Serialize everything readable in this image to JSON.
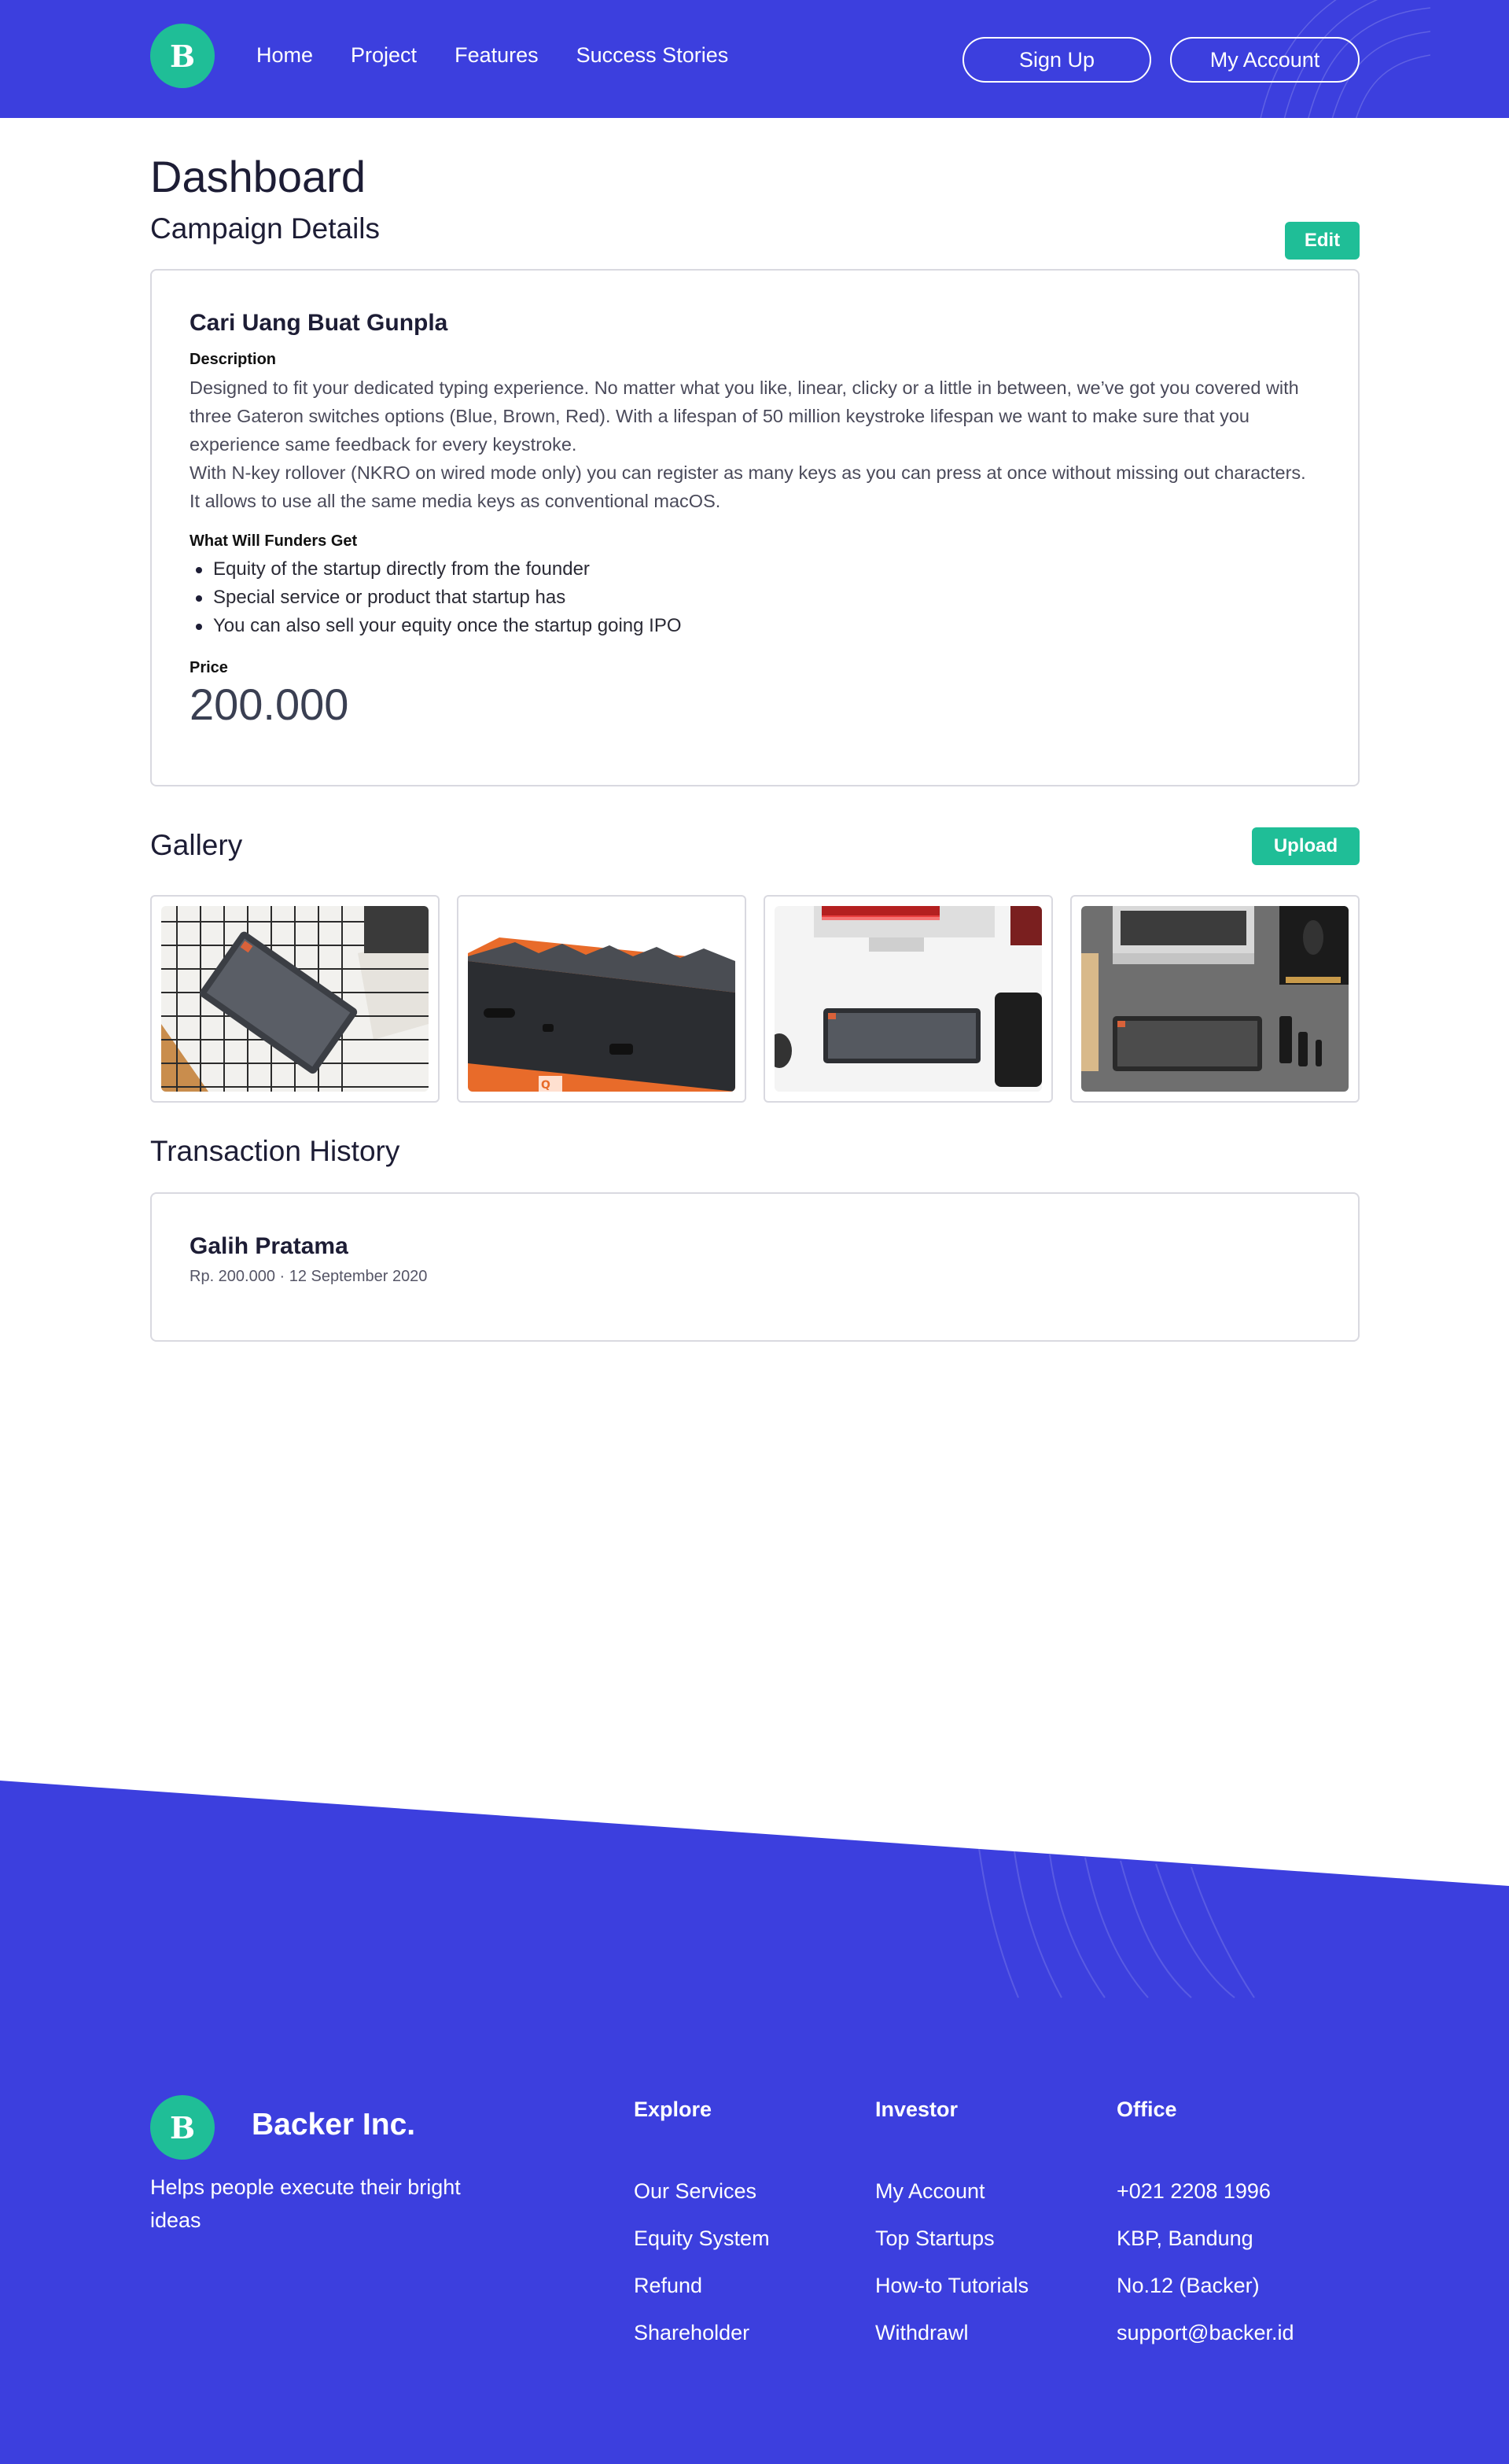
{
  "brand": {
    "logo_letter": "B",
    "name": "Backer Inc.",
    "tagline": "Helps people execute their bright ideas"
  },
  "header": {
    "nav": [
      "Home",
      "Project",
      "Features",
      "Success Stories"
    ],
    "signup_label": "Sign Up",
    "account_label": "My Account"
  },
  "main": {
    "page_title": "Dashboard",
    "campaign_section_title": "Campaign Details",
    "edit_label": "Edit",
    "campaign": {
      "name": "Cari Uang Buat Gunpla",
      "description_label": "Description",
      "description_1": "Designed to fit your dedicated typing experience. No matter what you like, linear, clicky or a little in between, we’ve got you covered with three Gateron switches options (Blue, Brown, Red). With a lifespan of 50 million keystroke lifespan we want to make sure that you experience same feedback for every keystroke.",
      "description_2": "With N-key rollover (NKRO on wired mode only) you can register as many keys as you can press at once without missing out characters. It allows to use all the same media keys as conventional macOS.",
      "benefits_label": "What Will Funders Get",
      "benefits": [
        "Equity of the startup directly from the founder",
        "Special service or product that startup has",
        "You can also sell your equity once the startup going IPO"
      ],
      "price_label": "Price",
      "price": "200.000"
    },
    "gallery_title": "Gallery",
    "upload_label": "Upload",
    "gallery": [
      "keyboard-on-grid-mat-photo",
      "keyboard-side-ports-photo",
      "keyboard-desk-setup-photo",
      "keyboard-laptop-flatlay-photo"
    ],
    "transactions_title": "Transaction History",
    "transactions": [
      {
        "name": "Galih Pratama",
        "meta": "Rp. 200.000 · 12 September 2020"
      }
    ]
  },
  "footer": {
    "columns": [
      {
        "title": "Explore",
        "links": [
          "Our Services",
          "Equity System",
          "Refund",
          "Shareholder"
        ]
      },
      {
        "title": "Investor",
        "links": [
          "My Account",
          "Top Startups",
          "How-to Tutorials",
          "Withdrawl"
        ]
      },
      {
        "title": "Office",
        "links": [
          "+021 2208 1996",
          "KBP, Bandung",
          "No.12 (Backer)",
          "support@backer.id"
        ]
      }
    ]
  },
  "colors": {
    "primary": "#3c3fde",
    "accent": "#1fbe97",
    "border": "#d9d9e0"
  }
}
